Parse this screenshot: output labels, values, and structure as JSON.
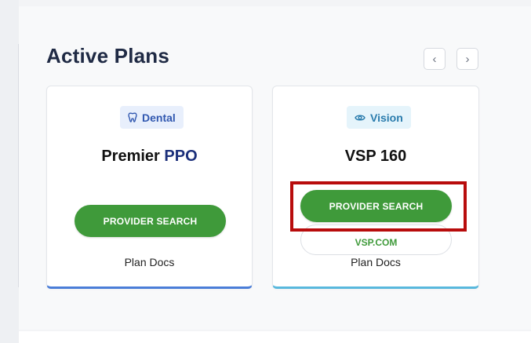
{
  "section": {
    "title": "Active Plans",
    "nav_prev": "‹",
    "nav_next": "›"
  },
  "plans": [
    {
      "badge": "Dental",
      "badge_icon": "tooth-icon",
      "name_prefix": "Premier ",
      "name_accent": "PPO",
      "provider_search": "PROVIDER SEARCH",
      "plan_docs": "Plan Docs",
      "accent_color": "#4a7dd8"
    },
    {
      "badge": "Vision",
      "badge_icon": "eye-icon",
      "name": "VSP 160",
      "provider_search": "PROVIDER SEARCH",
      "website": "VSP.COM",
      "plan_docs": "Plan Docs",
      "accent_color": "#58b8dd"
    }
  ],
  "colors": {
    "primary_button": "#3f9a3a",
    "title": "#1f2a44",
    "highlight_box": "#b80c0c"
  }
}
